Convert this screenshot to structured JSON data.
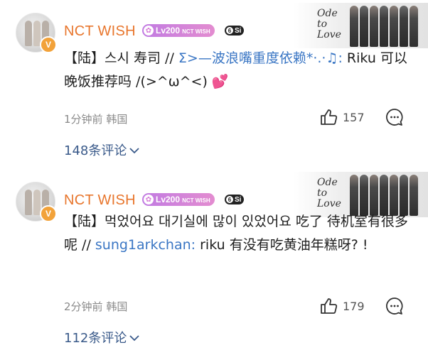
{
  "comments": [
    {
      "username": "NCT WISH",
      "level": "Lv200",
      "level_group": "NCT WISH",
      "svip": "Si",
      "verified_mark": "V",
      "text_prefix": "【陆】스시 寿司 // ",
      "mention": "Σ>—波浪嘴重度依赖*·.·♫:",
      "text_suffix": " Riku 可以晚饭推荐吗 /(>^ω^<)",
      "emoji": "💕",
      "time": "1分钟前",
      "location": "韩国",
      "likes": "157",
      "replies_label": "148条评论",
      "banner_logo": "Ode to Love"
    },
    {
      "username": "NCT WISH",
      "level": "Lv200",
      "level_group": "NCT WISH",
      "svip": "Si",
      "verified_mark": "V",
      "text_prefix": "【陆】먹었어요 대기실에 많이 있었어요 吃了 待机室有很多呢 // ",
      "mention": "sung1arkchan:",
      "text_suffix": " riku 有没有吃黄油年糕呀? !",
      "emoji": "",
      "time": "2分钟前",
      "location": "韩国",
      "likes": "179",
      "replies_label": "112条评论",
      "banner_logo": "Ode to Love"
    }
  ],
  "icons": {
    "like": "thumbs-up-icon",
    "reply": "chat-bubble-icon",
    "expand": "chevron-down-icon"
  },
  "colors": {
    "username": "#e8762d",
    "link": "#3a76c4",
    "meta": "#8a8a8a",
    "badge": "#c17be2"
  }
}
